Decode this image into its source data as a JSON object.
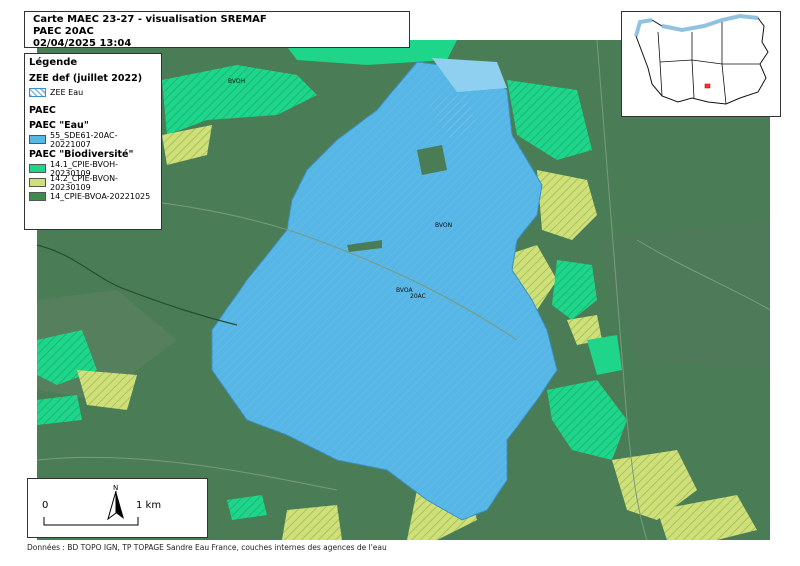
{
  "title": {
    "line1": "Carte MAEC 23-27 - visualisation SREMAF",
    "line2": "PAEC 20AC",
    "line3": "02/04/2025 13:04"
  },
  "legend": {
    "title": "Légende",
    "zee_section": "ZEE def (juillet 2022)",
    "zee_item": "ZEE Eau",
    "paec_section": "PAEC",
    "eau_section": "PAEC \"Eau\"",
    "eau_item": "55_SDE61-20AC-20221007",
    "bio_section": "PAEC \"Biodiversité\"",
    "bio_items": [
      {
        "label": "14.1_CPIE-BVOH-20230109",
        "color": "#1fd58a"
      },
      {
        "label": "14.2_CPIE-BVON-20230109",
        "color": "#cfe07a"
      },
      {
        "label": "14_CPIE-BVOA-20221025",
        "color": "#3f8a4f"
      }
    ],
    "zee_color": "#7fb8e6",
    "eau_color": "#56b6e6"
  },
  "map_labels": {
    "bvoh": "BVOH",
    "bvon": "BVON",
    "bvoa": "BVOA",
    "paec": "20AC"
  },
  "scale": {
    "zero": "0",
    "distance": "1 km",
    "north": "N"
  },
  "credits": "Données : BD TOPO IGN, TP TOPAGE Sandre Eau France, couches internes des agences de l'eau",
  "colors": {
    "base_green": "#4a7d55",
    "bright_green": "#1fd58a",
    "light_yellow": "#cfe07a",
    "water_blue": "#56b6e6"
  }
}
